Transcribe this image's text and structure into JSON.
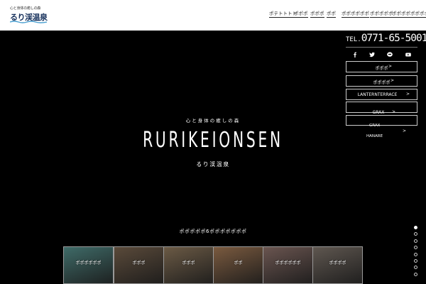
{
  "header": {
    "logo_tagline": "心と身体の癒しの森",
    "logo_text": "るり渓温泉",
    "nav": [
      "ポテトトトト",
      "ポポポ",
      "ポポポ",
      "ポポ",
      "ポポポポポポ",
      "ポポポポポ",
      "ポポポポポポポポ"
    ]
  },
  "contact": {
    "tel_prefix": "TEL.",
    "tel_number": "0771-65-5001"
  },
  "social": [
    "facebook-icon",
    "twitter-icon",
    "line-icon",
    "youtube-icon"
  ],
  "side_menu": {
    "buttons": [
      "ポポポ",
      "ポポポポ",
      "LANTERNTERRACE",
      "GRAX"
    ],
    "floating_labels": [
      "GRAX",
      "HANARE"
    ],
    "chevron": ">"
  },
  "hero": {
    "catch": "心と身体の癒しの森",
    "title": "RURIKEIONSEN",
    "subtitle": "るり渓温泉"
  },
  "enjoy_heading": "ポポポポポ6ポポポポポポポ",
  "thumbnails": [
    {
      "label": "ポポポポポポ",
      "color": "#3f6b68"
    },
    {
      "label": "ポポポ",
      "color": "#5a4a3a"
    },
    {
      "label": "ポポポ",
      "color": "#6b5a45"
    },
    {
      "label": "ポポ",
      "color": "#7a5a3f"
    },
    {
      "label": "ポポポポポポ",
      "color": "#6a5550"
    },
    {
      "label": "ポポポポ",
      "color": "#5f5750"
    }
  ],
  "slider": {
    "count": 8,
    "active_index": 0
  }
}
